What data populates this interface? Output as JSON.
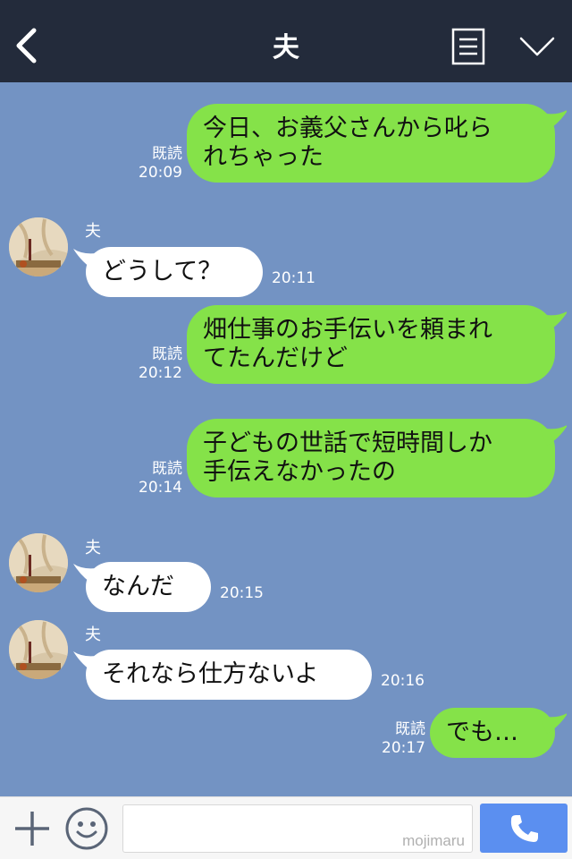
{
  "header": {
    "title": "夫",
    "back_icon": "chevron-left-icon",
    "menu_icon": "menu-list-icon",
    "expand_icon": "chevron-down-icon"
  },
  "colors": {
    "header_bg": "#232b3b",
    "chat_bg": "#7393c3",
    "my_bubble": "#85e249",
    "their_bubble": "#ffffff",
    "call_button": "#5b8ff0"
  },
  "messages": [
    {
      "from": "me",
      "lines": [
        "今日、お義父さんから叱ら",
        "れちゃった"
      ],
      "read": "既読",
      "time": "20:09"
    },
    {
      "from": "them",
      "sender": "夫",
      "lines": [
        "どうして？"
      ],
      "time": "20:11"
    },
    {
      "from": "me",
      "lines": [
        "畑仕事のお手伝いを頼まれ",
        "てたんだけど"
      ],
      "read": "既読",
      "time": "20:12"
    },
    {
      "from": "me",
      "lines": [
        "子どもの世話で短時間しか",
        "手伝えなかったの"
      ],
      "read": "既読",
      "time": "20:14"
    },
    {
      "from": "them",
      "sender": "夫",
      "lines": [
        "なんだ"
      ],
      "time": "20:15"
    },
    {
      "from": "them",
      "sender": "夫",
      "lines": [
        "それなら仕方ないよ"
      ],
      "time": "20:16"
    },
    {
      "from": "me",
      "lines": [
        "でも…"
      ],
      "read": "既読",
      "time": "20:17"
    }
  ],
  "input": {
    "placeholder": "",
    "watermark": "mojimaru"
  },
  "bottom_icons": {
    "plus": "plus-icon",
    "emoji": "smiley-icon",
    "call": "phone-icon"
  }
}
